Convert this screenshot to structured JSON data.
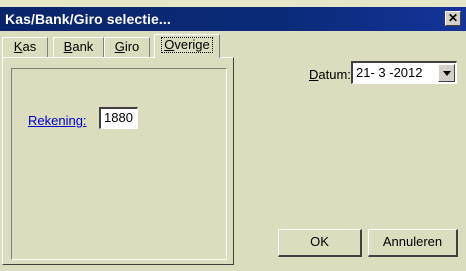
{
  "window": {
    "title": "Kas/Bank/Giro selectie...",
    "close_glyph": "✕"
  },
  "tabs": [
    {
      "label_ul": "K",
      "label_rest": "as"
    },
    {
      "label_ul": "B",
      "label_rest": "ank"
    },
    {
      "label_ul": "G",
      "label_rest": "iro"
    },
    {
      "label_ul": "O",
      "label_rest": "verige",
      "active": true
    }
  ],
  "overige": {
    "rekening_label": "Rekening:",
    "rekening_value": "1880"
  },
  "datum": {
    "label_ul": "D",
    "label_rest": "atum:",
    "value": "21- 3 -2012"
  },
  "buttons": {
    "ok": "OK",
    "cancel": "Annuleren"
  },
  "colors": {
    "titlebar": "#0a246a",
    "dialog_bg": "#dcdcbe",
    "link": "#0000cc"
  },
  "icons": {
    "close": "close-icon",
    "dropdown": "chevron-down-icon"
  }
}
